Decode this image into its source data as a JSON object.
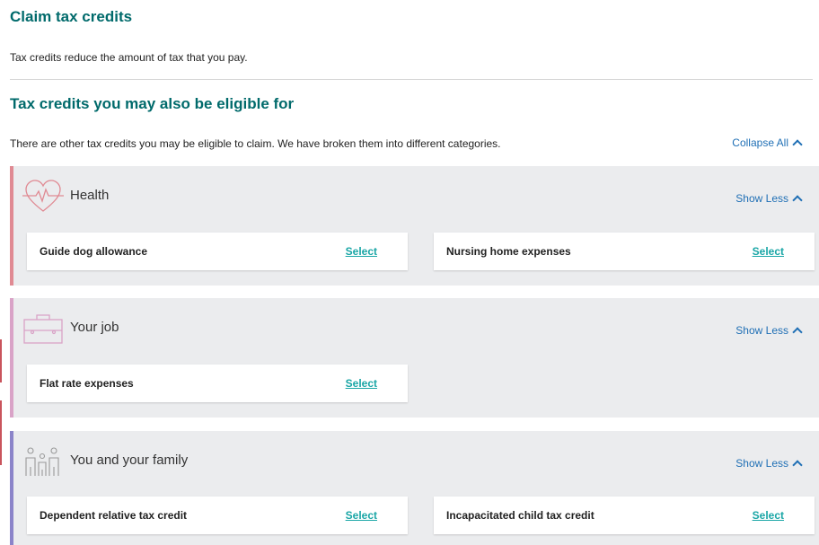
{
  "header": {
    "title": "Claim tax credits",
    "intro": "Tax credits reduce the amount of tax that you pay."
  },
  "section": {
    "title": "Tax credits you may also be eligible for",
    "description": "There are other tax credits you may be eligible to claim. We have broken them into different categories.",
    "collapse_all": "Collapse All"
  },
  "categories": [
    {
      "label": "Health",
      "icon": "heart-pulse-icon",
      "accent": "#e08a93",
      "toggle": "Show Less",
      "items": [
        {
          "label": "Guide dog allowance",
          "action": "Select"
        },
        {
          "label": "Nursing home expenses",
          "action": "Select"
        }
      ]
    },
    {
      "label": "Your job",
      "icon": "briefcase-icon",
      "accent": "#d9a3c7",
      "toggle": "Show Less",
      "items": [
        {
          "label": "Flat rate expenses",
          "action": "Select"
        }
      ]
    },
    {
      "label": "You and your family",
      "icon": "family-icon",
      "accent": "#8b84c9",
      "toggle": "Show Less",
      "items": [
        {
          "label": "Dependent relative tax credit",
          "action": "Select"
        },
        {
          "label": "Incapacitated child tax credit",
          "action": "Select"
        }
      ]
    }
  ],
  "colors": {
    "heading": "#006a6b",
    "link": "#1f6fb5",
    "select": "#1aa6a6",
    "panel": "#ebecee"
  }
}
